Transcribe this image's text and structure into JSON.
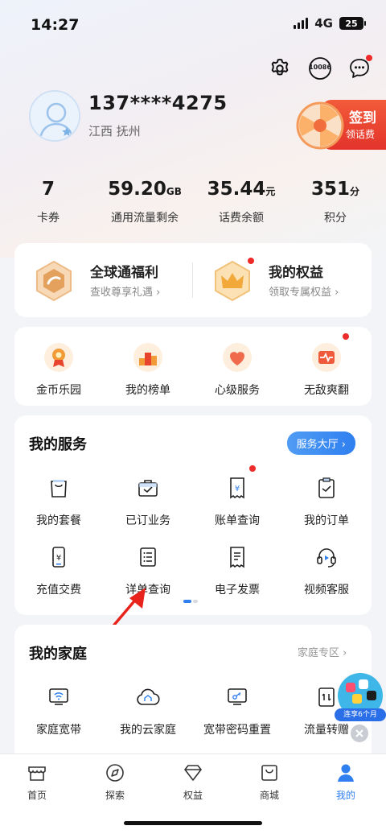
{
  "status": {
    "time": "14:27",
    "network": "4G",
    "battery": "25"
  },
  "header_icons": {
    "service_number": "10086"
  },
  "profile": {
    "phone": "137****4275",
    "location": "江西 抚州"
  },
  "checkin": {
    "line1": "签到",
    "line2": "领话费"
  },
  "stats": [
    {
      "value": "7",
      "unit": "",
      "label": "卡券"
    },
    {
      "value": "59.20",
      "unit": "GB",
      "label": "通用流量剩余"
    },
    {
      "value": "35.44",
      "unit": "元",
      "label": "话费余额"
    },
    {
      "value": "351",
      "unit": "分",
      "label": "积分"
    }
  ],
  "benefits": [
    {
      "title": "全球通福利",
      "subtitle": "查收尊享礼遇 ›"
    },
    {
      "title": "我的权益",
      "subtitle": "领取专属权益 ›"
    }
  ],
  "activities": [
    {
      "label": "金币乐园"
    },
    {
      "label": "我的榜单"
    },
    {
      "label": "心级服务"
    },
    {
      "label": "无敌爽翻"
    }
  ],
  "services": {
    "title": "我的服务",
    "hall_button": "服务大厅 ›",
    "items": [
      {
        "label": "我的套餐"
      },
      {
        "label": "已订业务"
      },
      {
        "label": "账单查询"
      },
      {
        "label": "我的订单"
      },
      {
        "label": "充值交费"
      },
      {
        "label": "详单查询"
      },
      {
        "label": "电子发票"
      },
      {
        "label": "视频客服"
      }
    ]
  },
  "family": {
    "title": "我的家庭",
    "zone_link": "家庭专区 ›",
    "items": [
      {
        "label": "家庭宽带"
      },
      {
        "label": "我的云家庭"
      },
      {
        "label": "宽带密码重置"
      },
      {
        "label": "流量转赠"
      }
    ]
  },
  "promo": {
    "text": "连享6个月"
  },
  "tabs": [
    {
      "label": "首页"
    },
    {
      "label": "探索"
    },
    {
      "label": "权益"
    },
    {
      "label": "商城"
    },
    {
      "label": "我的"
    }
  ],
  "colors": {
    "accent_blue": "#2f7ff0",
    "badge_red": "#ee2a2a",
    "active_tab": "#2f7ff0",
    "annotation_arrow": "#e8231c"
  }
}
